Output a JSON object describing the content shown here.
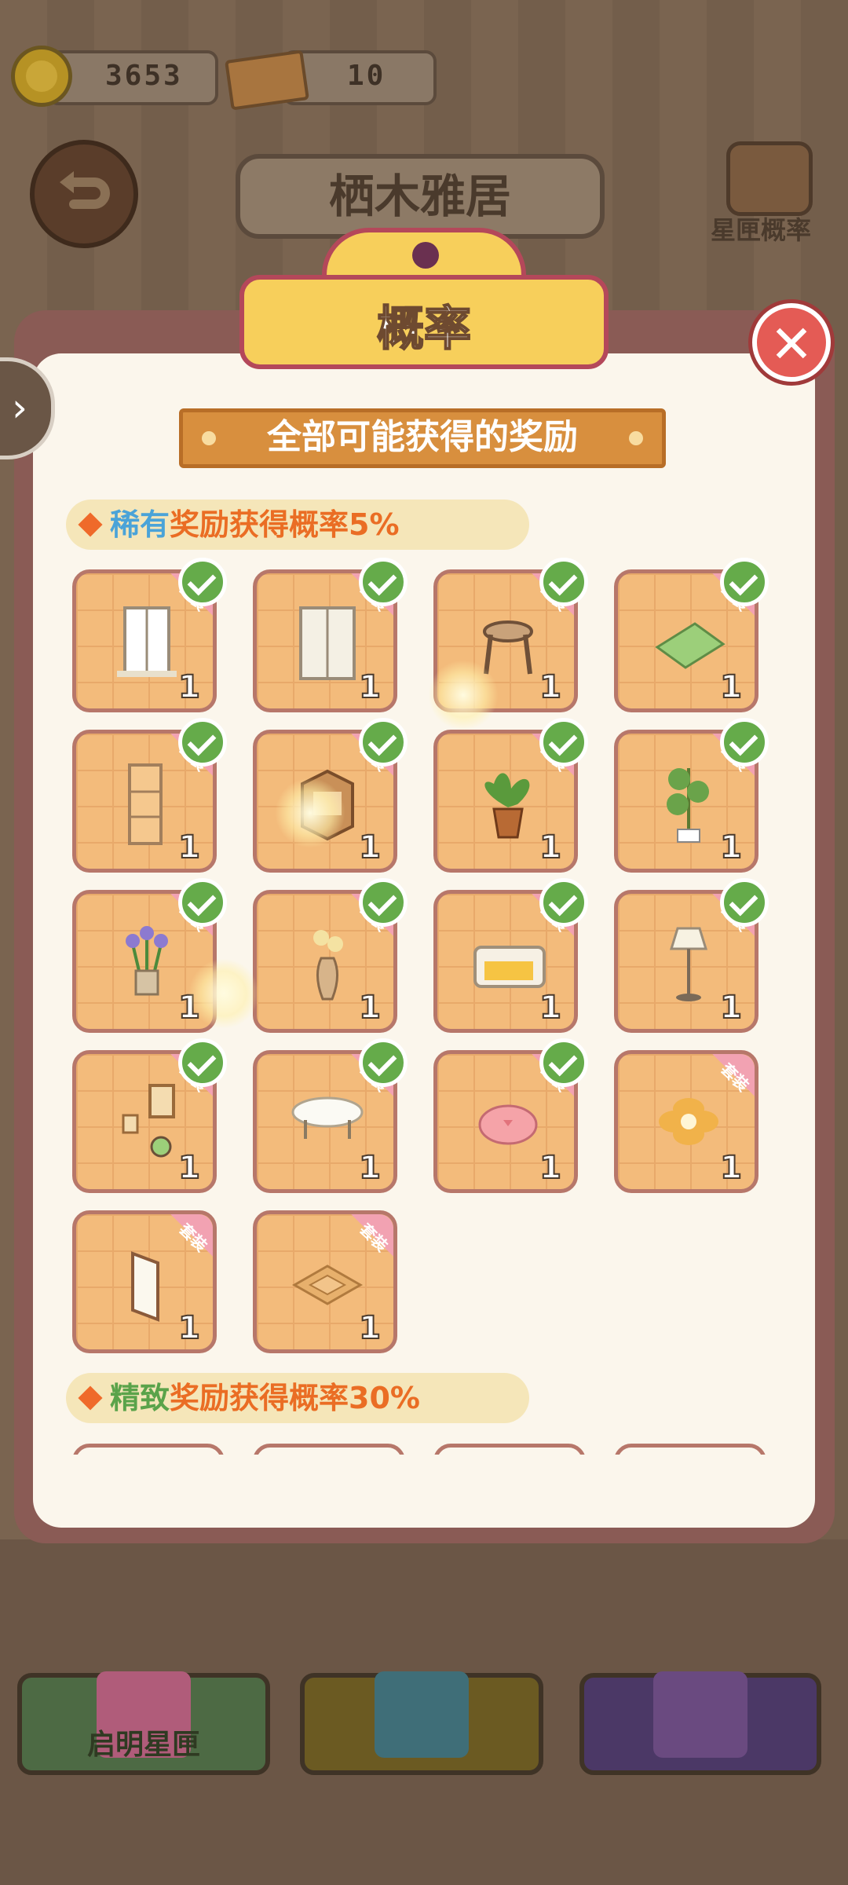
{
  "currency": {
    "coins": "3653",
    "tickets": "10"
  },
  "scene": {
    "title": "栖木雅居",
    "prob_button_label": "星匣概率"
  },
  "modal": {
    "title": "概率",
    "close_label": "✕",
    "banner": "全部可能获得的奖励",
    "sections": [
      {
        "parts": [
          "稀有",
          "奖励获得概率5%"
        ]
      },
      {
        "parts": [
          "精致",
          "奖励获得概率30%"
        ]
      }
    ],
    "items": [
      {
        "name": "window",
        "count": "1",
        "tag": "套装",
        "owned": true
      },
      {
        "name": "curtain-window",
        "count": "1",
        "tag": "套装",
        "owned": true
      },
      {
        "name": "stool",
        "count": "1",
        "tag": "套装",
        "owned": true
      },
      {
        "name": "green-rug",
        "count": "1",
        "tag": "套装",
        "owned": true
      },
      {
        "name": "wall-panel",
        "count": "1",
        "tag": "套装",
        "owned": true
      },
      {
        "name": "bookshelf",
        "count": "1",
        "tag": "套装",
        "owned": true
      },
      {
        "name": "potted-plant",
        "count": "1",
        "tag": "套装",
        "owned": true
      },
      {
        "name": "tall-plant",
        "count": "1",
        "tag": "套装",
        "owned": true
      },
      {
        "name": "flower-pot",
        "count": "1",
        "tag": "套装",
        "owned": true
      },
      {
        "name": "vase",
        "count": "1",
        "tag": "套装",
        "owned": true
      },
      {
        "name": "sofa",
        "count": "1",
        "tag": "套装",
        "owned": true
      },
      {
        "name": "floor-lamp",
        "count": "1",
        "tag": "套装",
        "owned": true
      },
      {
        "name": "picture-frames",
        "count": "1",
        "tag": "套装",
        "owned": true
      },
      {
        "name": "coffee-table",
        "count": "1",
        "tag": "套装",
        "owned": true
      },
      {
        "name": "pink-cushion",
        "count": "1",
        "tag": "套装",
        "owned": true
      },
      {
        "name": "flower-mat",
        "count": "1",
        "tag": "套装",
        "owned": false
      },
      {
        "name": "wall-mirror",
        "count": "1",
        "tag": "套装",
        "owned": false
      },
      {
        "name": "floor-tile",
        "count": "1",
        "tag": "套装",
        "owned": false
      }
    ]
  },
  "bottom": {
    "gift1_label": "启明星匣"
  }
}
